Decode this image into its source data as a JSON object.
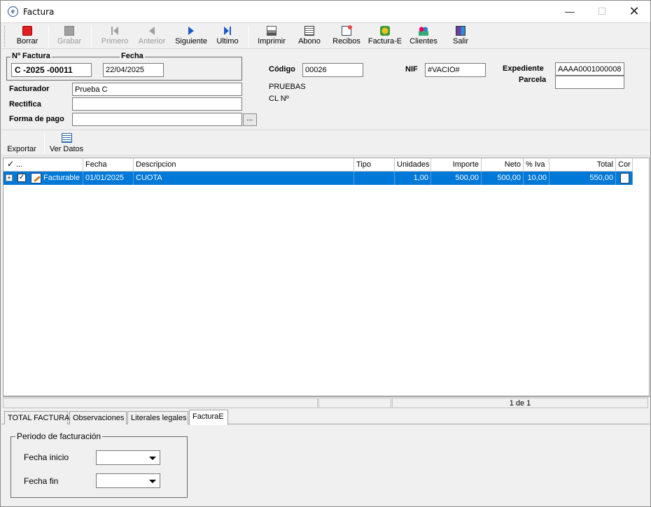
{
  "window": {
    "title": "Factura",
    "icon": "e-app-icon"
  },
  "toolbar": {
    "buttons": [
      {
        "label": "Borrar",
        "icon": "delete-icon",
        "enabled": true
      },
      {
        "label": "Grabar",
        "icon": "save-icon",
        "enabled": false
      },
      {
        "label": "Primero",
        "icon": "first-record-icon",
        "enabled": false
      },
      {
        "label": "Anterior",
        "icon": "previous-record-icon",
        "enabled": false
      },
      {
        "label": "Siguiente",
        "icon": "next-record-icon",
        "enabled": true
      },
      {
        "label": "Ultimo",
        "icon": "last-record-icon",
        "enabled": true
      },
      {
        "label": "Imprimir",
        "icon": "printer-icon",
        "enabled": true
      },
      {
        "label": "Abono",
        "icon": "document-icon",
        "enabled": true
      },
      {
        "label": "Recibos",
        "icon": "receipt-icon",
        "enabled": true
      },
      {
        "label": "Factura-E",
        "icon": "e-invoice-icon",
        "enabled": true
      },
      {
        "label": "Clientes",
        "icon": "clients-icon",
        "enabled": true
      },
      {
        "label": "Salir",
        "icon": "exit-door-icon",
        "enabled": true
      }
    ]
  },
  "header": {
    "nfactura_label": "Nº Factura",
    "nfactura_value": "C  -2025  -00011",
    "fecha_label": "Fecha",
    "fecha_value": "22/04/2025",
    "facturador_label": "Facturador",
    "facturador_value": "Prueba C",
    "rectifica_label": "Rectifica",
    "rectifica_value": "",
    "forma_pago_label": "Forma de pago",
    "forma_pago_value": "",
    "forma_pago_button": "...",
    "codigo_label": "Código",
    "codigo_value": "00026",
    "client_name": "PRUEBAS",
    "client_line2": "CL  Nº",
    "nif_label": "NIF",
    "nif_value": "#VACIO#",
    "expediente_label": "Expediente",
    "expediente_value": "AAAA0001000008",
    "parcela_label": "Parcela",
    "parcela_value": ""
  },
  "subtoolbar": {
    "exportar_label": "Exportar",
    "ver_datos_label": "Ver Datos"
  },
  "grid": {
    "columns": {
      "check": "...",
      "fecha": "Fecha",
      "descripcion": "Descripcion",
      "tipo": "Tipo",
      "unidades": "Unidades",
      "importe": "Importe",
      "neto": "Neto",
      "iva": "% Iva",
      "total": "Total",
      "con": "Cor"
    },
    "rows": [
      {
        "estado": "Facturable",
        "fecha": "01/01/2025",
        "descripcion": "CUOTA",
        "tipo": "",
        "unidades": "1,00",
        "importe": "500,00",
        "neto": "500,00",
        "iva": "10,00",
        "total": "550,00"
      }
    ]
  },
  "status": {
    "pager": "1 de 1"
  },
  "tabs": [
    {
      "label": "TOTAL FACTURA"
    },
    {
      "label": "Observaciones"
    },
    {
      "label": "Literales legales"
    },
    {
      "label": "FacturaE"
    }
  ],
  "facturae": {
    "group_label": "Periodo de facturación",
    "fecha_inicio_label": "Fecha inicio",
    "fecha_fin_label": "Fecha fin"
  },
  "colors": {
    "selection": "#0078d7",
    "background": "#f0f0f0"
  }
}
